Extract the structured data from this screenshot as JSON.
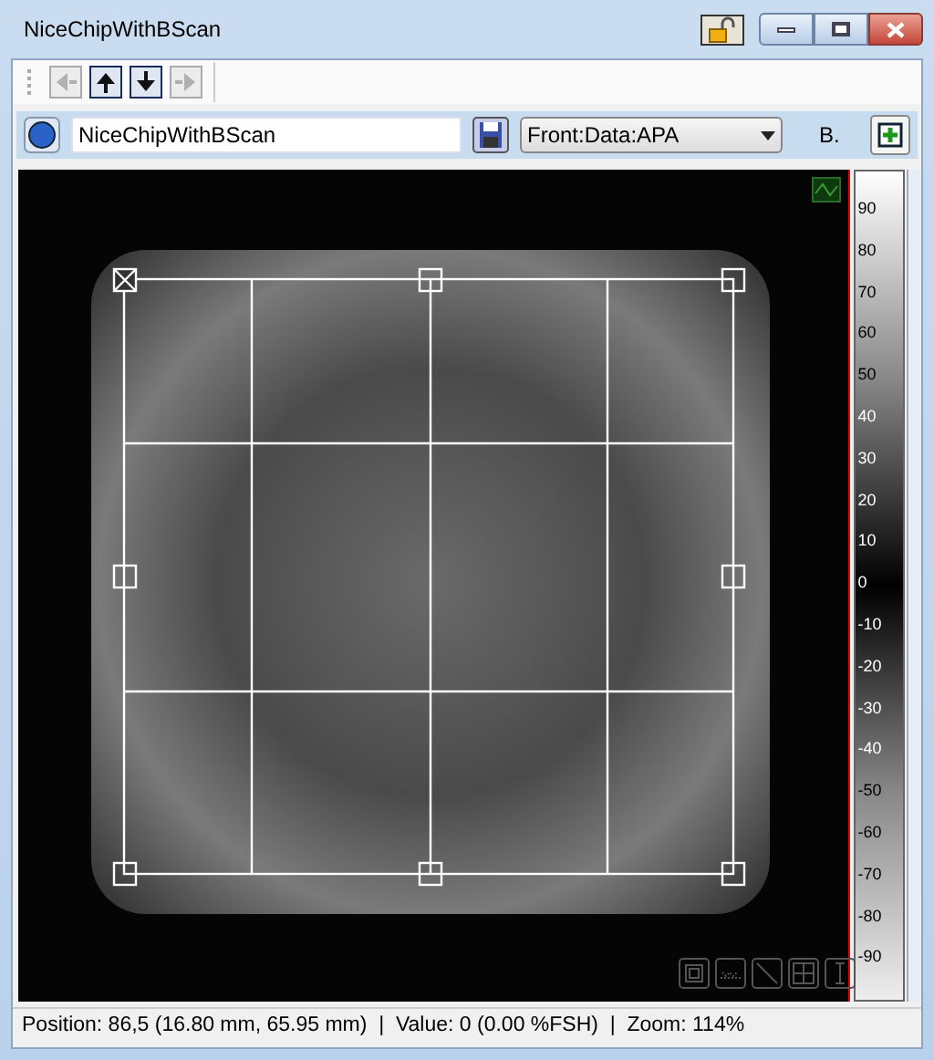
{
  "window": {
    "title": "NiceChipWithBScan"
  },
  "toolbar": [
    {
      "kind": "left",
      "disabled": true
    },
    {
      "kind": "up",
      "disabled": false
    },
    {
      "kind": "down",
      "disabled": false
    },
    {
      "kind": "right",
      "disabled": true
    }
  ],
  "name_field": {
    "value": "NiceChipWithBScan"
  },
  "view_dropdown": {
    "value": "Front:Data:APA"
  },
  "mode_label": "B.",
  "color_scale": [
    "90",
    "80",
    "70",
    "60",
    "50",
    "40",
    "30",
    "20",
    "10",
    "0",
    "-10",
    "-20",
    "-30",
    "-40",
    "-50",
    "-60",
    "-70",
    "-80",
    "-90"
  ],
  "status_bar": "Position: 86,5 (16.80 mm, 65.95 mm)  |  Value: 0 (0.00 %FSH)  |  Zoom: 114%"
}
